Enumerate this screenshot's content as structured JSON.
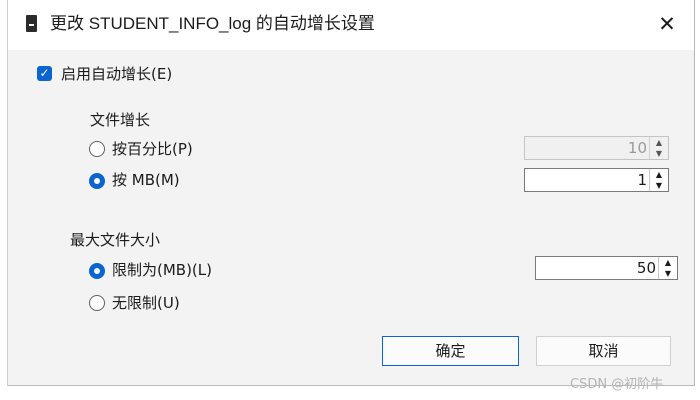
{
  "window": {
    "title": "更改 STUDENT_INFO_log 的自动增长设置",
    "close_symbol": "✕",
    "icon": "database-icon"
  },
  "autogrowth": {
    "enable_label": "启用自动增长(E)",
    "checked": true,
    "check_symbol": "✓"
  },
  "file_growth": {
    "group_label": "文件增长",
    "percent_option": {
      "label": "按百分比(P)",
      "selected": false,
      "value": "10"
    },
    "mb_option": {
      "label": "按 MB(M)",
      "selected": true,
      "value": "1"
    }
  },
  "max_size": {
    "group_label": "最大文件大小",
    "limit_option": {
      "label": "限制为(MB)(L)",
      "selected": true,
      "value": "50"
    },
    "unlimited_option": {
      "label": "无限制(U)",
      "selected": false
    }
  },
  "spinner": {
    "up_symbol": "▲",
    "down_symbol": "▼"
  },
  "buttons": {
    "ok": "确定",
    "cancel": "取消"
  },
  "watermark": "CSDN @初阶牛",
  "colors": {
    "accent": "#0a64d1",
    "dialog_background": "#f3f3f3",
    "title_background": "#ffffff"
  }
}
